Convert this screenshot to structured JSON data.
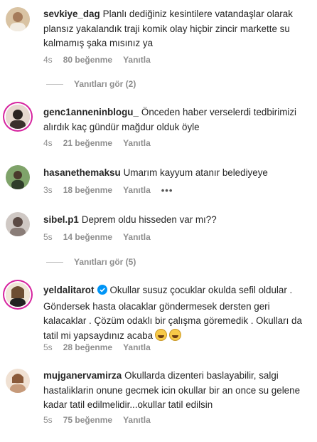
{
  "comments": [
    {
      "user": "sevkiye_dag",
      "text": "Planlı dediğiniz kesintilere vatandaşlar olarak plansız yakalandık traji komik olay hiçbir zincir markette su kalmamış şaka mısınız ya",
      "time": "4s",
      "likes": "80 beğenme",
      "reply": "Yanıtla",
      "view_replies": "Yanıtları gör (2)"
    },
    {
      "user": "genc1anneninblogu_",
      "text": "Önceden haber verselerdi tedbirimizi alırdık kaç gündür mağdur olduk öyle",
      "time": "4s",
      "likes": "21 beğenme",
      "reply": "Yanıtla"
    },
    {
      "user": "hasanethemaksu",
      "text": "Umarım kayyum atanır belediyeye",
      "time": "3s",
      "likes": "18 beğenme",
      "reply": "Yanıtla",
      "more": "•••"
    },
    {
      "user": "sibel.p1",
      "text": "Deprem oldu hisseden var mı??",
      "time": "5s",
      "likes": "14 beğenme",
      "reply": "Yanıtla",
      "view_replies": "Yanıtları gör (5)"
    },
    {
      "user": "yeldalitarot",
      "text": "Okullar susuz çocuklar okulda sefil oldular . Göndersek hasta olacaklar göndermesek dersten geri kalacaklar . Çözüm odaklı bir çalışma göremedik . Okulları da tatil mi yapsaydınız acaba",
      "time": "5s",
      "likes": "28 beğenme",
      "reply": "Yanıtla"
    },
    {
      "user": "mujganervamirza",
      "text": "Okullarda dizenteri baslayabilir, salgi hastaliklarin onune gecmek icin okullar bir an once su gelene kadar tatil edilmelidir...okullar tatil edilsin",
      "time": "5s",
      "likes": "75 beğenme",
      "reply": "Yanıtla"
    }
  ],
  "colors": {
    "text": "#262626",
    "muted": "#8e8e8e",
    "story_ring": "#d6249f",
    "verified": "#0095f6"
  },
  "icons": {
    "verified": "verified-badge-icon",
    "emoji_1": "grinning-face-emoji",
    "emoji_2": "smiling-face-emoji"
  }
}
